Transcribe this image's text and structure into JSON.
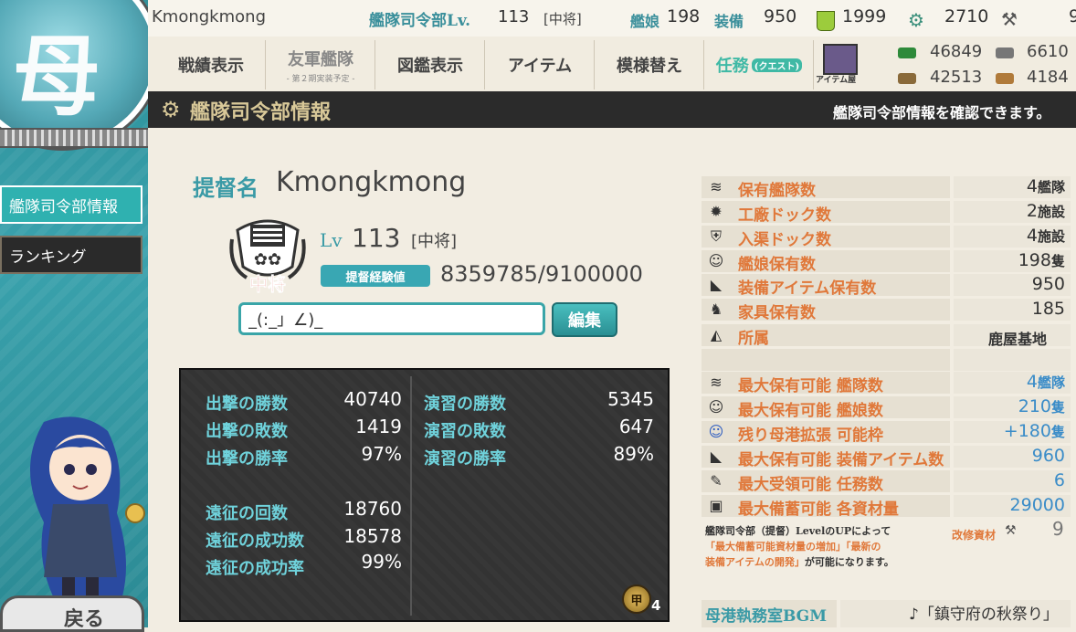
{
  "header": {
    "username": "Kmongkmong",
    "hq_label": "艦隊司令部Lv.",
    "hq_level": "113",
    "hq_rank": "[中将]",
    "ships_label": "艦娘",
    "ships_value": "198",
    "equip_label": "装備",
    "equip_value": "950",
    "bucket_value": "1999",
    "devmat_value": "2710",
    "edge_value": "9"
  },
  "nav": {
    "record": "戦績表示",
    "friend_fleet": "友軍艦隊",
    "friend_fleet_sub": "- 第２期実装予定 -",
    "library": "図鑑表示",
    "items": "アイテム",
    "remodel": "模様替え",
    "quest": "任務",
    "quest_sub": "(クエスト)",
    "item_shop": "アイテム屋"
  },
  "resources": {
    "fuel": "46849",
    "ammo_partial": "6610",
    "steel": "42513",
    "bauxite_partial": "4184"
  },
  "section": {
    "title": "艦隊司令部情報",
    "description": "艦隊司令部情報を確認できます。"
  },
  "sidebar": {
    "items": [
      {
        "label": "艦隊司令部情報"
      },
      {
        "label": "ランキング"
      }
    ],
    "back_label": "戻る"
  },
  "profile": {
    "admiral_label": "提督名",
    "admiral_name": "Kmongkmong",
    "rank_emblem_text": "中将",
    "lv_label": "Lv",
    "lv_value": "113",
    "rank": "[中将]",
    "exp_label": "提督経験値",
    "exp_value": "8359785/9100000",
    "comment": "_(:_」∠)_",
    "edit_label": "編集"
  },
  "record": {
    "sortie": [
      {
        "label": "出撃の勝数",
        "value": "40740"
      },
      {
        "label": "出撃の敗数",
        "value": "1419"
      },
      {
        "label": "出撃の勝率",
        "value": "97%"
      }
    ],
    "exercise": [
      {
        "label": "演習の勝数",
        "value": "5345"
      },
      {
        "label": "演習の敗数",
        "value": "647"
      },
      {
        "label": "演習の勝率",
        "value": "89%"
      }
    ],
    "expedition": [
      {
        "label": "遠征の回数",
        "value": "18760"
      },
      {
        "label": "遠征の成功数",
        "value": "18578"
      },
      {
        "label": "遠征の成功率",
        "value": "99%"
      }
    ],
    "medal_glyph": "甲",
    "medal_count": "4"
  },
  "stats": {
    "current": [
      {
        "label": "保有艦隊数",
        "value": "4",
        "unit": "艦隊",
        "icon": "fleet-icon"
      },
      {
        "label": "工廠ドック数",
        "value": "2",
        "unit": "施設",
        "icon": "gear-icon"
      },
      {
        "label": "入渠ドック数",
        "value": "4",
        "unit": "施設",
        "icon": "repair-icon"
      },
      {
        "label": "艦娘保有数",
        "value": "198",
        "unit": "隻",
        "icon": "shipgirl-icon"
      },
      {
        "label": "装備アイテム保有数",
        "value": "950",
        "unit": "",
        "icon": "equipment-icon"
      },
      {
        "label": "家具保有数",
        "value": "185",
        "unit": "",
        "icon": "furniture-icon"
      },
      {
        "label": "所属",
        "value": "鹿屋基地",
        "unit": "",
        "icon": "base-icon"
      }
    ],
    "max": [
      {
        "label": "最大保有可能 艦隊数",
        "value": "4",
        "unit": "艦隊",
        "icon": "fleet-icon"
      },
      {
        "label": "最大保有可能 艦娘数",
        "value": "210",
        "unit": "隻",
        "icon": "shipgirl-icon"
      },
      {
        "label": "残り母港拡張 可能枠",
        "value": "+180",
        "unit": "隻",
        "icon": "shipgirl-blue-icon"
      },
      {
        "label": "最大保有可能 装備アイテム数",
        "value": "960",
        "unit": "",
        "icon": "equipment-icon"
      },
      {
        "label": "最大受領可能 任務数",
        "value": "6",
        "unit": "",
        "icon": "quill-icon"
      },
      {
        "label": "最大備蓄可能 各資材量",
        "value": "29000",
        "unit": "",
        "icon": "book-icon"
      }
    ],
    "note_line1": "艦隊司令部（提督）LevelのUPによって",
    "note_line2": "「最大備蓄可能資材量の増加」「最新の",
    "note_line3": "装備アイテムの開発」",
    "note_line3_tail": "が可能になります。",
    "improve_label": "改修資材",
    "improve_value": "9",
    "bgm_label": "母港執務室BGM",
    "bgm_value": "♪「鎮守府の秋祭り」"
  },
  "colors": {
    "teal": "#3a9aa6",
    "orange": "#e0783a",
    "dark_panel": "#333333"
  }
}
